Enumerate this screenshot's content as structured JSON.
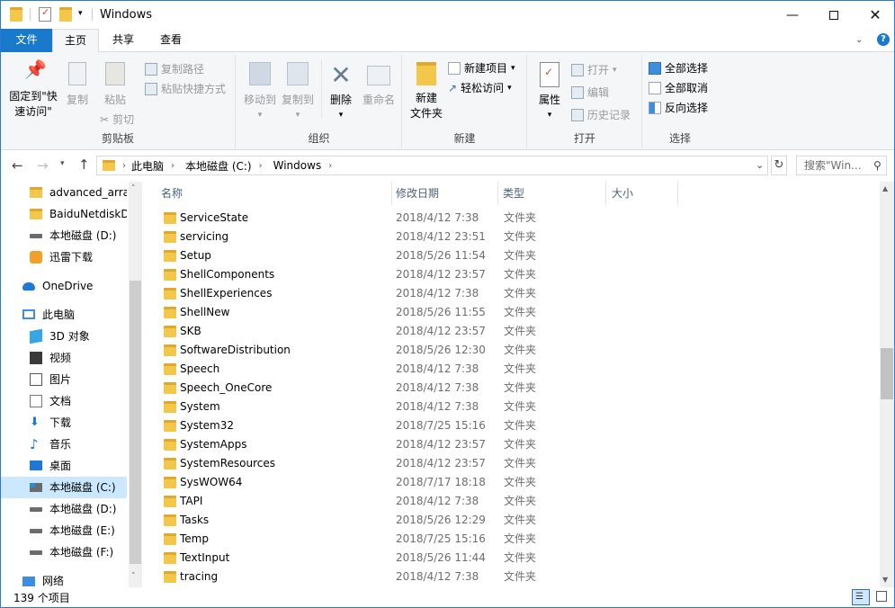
{
  "window": {
    "title": "Windows"
  },
  "tabs": {
    "file": "文件",
    "home": "主页",
    "share": "共享",
    "view": "查看"
  },
  "ribbon": {
    "clipboard": {
      "label": "剪贴板",
      "pin": "固定到\"快",
      "pin2": "速访问\"",
      "copy": "复制",
      "paste": "粘贴",
      "copy_path": "复制路径",
      "paste_shortcut": "粘贴快捷方式",
      "cut": "剪切"
    },
    "organize": {
      "label": "组织",
      "move_to": "移动到",
      "copy_to": "复制到",
      "delete": "删除",
      "rename": "重命名"
    },
    "new": {
      "label": "新建",
      "new_folder": "新建",
      "new_folder2": "文件夹",
      "new_item": "新建项目",
      "easy_access": "轻松访问"
    },
    "open": {
      "label": "打开",
      "properties": "属性",
      "open": "打开",
      "edit": "编辑",
      "history": "历史记录"
    },
    "select": {
      "label": "选择",
      "select_all": "全部选择",
      "select_none": "全部取消",
      "invert": "反向选择"
    }
  },
  "address": {
    "crumbs": [
      "此电脑",
      "本地磁盘 (C:)",
      "Windows"
    ],
    "search_placeholder": "搜索\"Win..."
  },
  "nav": [
    {
      "label": "advanced_arra",
      "icon": "folder-icon"
    },
    {
      "label": "BaiduNetdiskD",
      "icon": "folder-icon"
    },
    {
      "label": "本地磁盘 (D:)",
      "icon": "drive-icon"
    },
    {
      "label": "迅雷下载",
      "icon": "thunder-icon"
    },
    {
      "label": "OneDrive",
      "icon": "cloud-icon"
    },
    {
      "label": "此电脑",
      "icon": "computer-icon"
    },
    {
      "label": "3D 对象",
      "icon": "cube-icon"
    },
    {
      "label": "视频",
      "icon": "video-icon"
    },
    {
      "label": "图片",
      "icon": "picture-icon"
    },
    {
      "label": "文档",
      "icon": "document-icon"
    },
    {
      "label": "下载",
      "icon": "download-icon"
    },
    {
      "label": "音乐",
      "icon": "music-icon"
    },
    {
      "label": "桌面",
      "icon": "desktop-icon"
    },
    {
      "label": "本地磁盘 (C:)",
      "icon": "windows-drive-icon"
    },
    {
      "label": "本地磁盘 (D:)",
      "icon": "drive-icon"
    },
    {
      "label": "本地磁盘 (E:)",
      "icon": "drive-icon"
    },
    {
      "label": "本地磁盘 (F:)",
      "icon": "drive-icon"
    },
    {
      "label": "网络",
      "icon": "network-icon"
    }
  ],
  "columns": {
    "name": "名称",
    "date": "修改日期",
    "type": "类型",
    "size": "大小"
  },
  "files": [
    {
      "name": "ServiceState",
      "date": "2018/4/12 7:38",
      "type": "文件夹"
    },
    {
      "name": "servicing",
      "date": "2018/4/12 23:51",
      "type": "文件夹"
    },
    {
      "name": "Setup",
      "date": "2018/5/26 11:54",
      "type": "文件夹"
    },
    {
      "name": "ShellComponents",
      "date": "2018/4/12 23:57",
      "type": "文件夹"
    },
    {
      "name": "ShellExperiences",
      "date": "2018/4/12 7:38",
      "type": "文件夹"
    },
    {
      "name": "ShellNew",
      "date": "2018/5/26 11:55",
      "type": "文件夹"
    },
    {
      "name": "SKB",
      "date": "2018/4/12 23:57",
      "type": "文件夹"
    },
    {
      "name": "SoftwareDistribution",
      "date": "2018/5/26 12:30",
      "type": "文件夹"
    },
    {
      "name": "Speech",
      "date": "2018/4/12 7:38",
      "type": "文件夹"
    },
    {
      "name": "Speech_OneCore",
      "date": "2018/4/12 7:38",
      "type": "文件夹"
    },
    {
      "name": "System",
      "date": "2018/4/12 7:38",
      "type": "文件夹"
    },
    {
      "name": "System32",
      "date": "2018/7/25 15:16",
      "type": "文件夹"
    },
    {
      "name": "SystemApps",
      "date": "2018/4/12 23:57",
      "type": "文件夹"
    },
    {
      "name": "SystemResources",
      "date": "2018/4/12 23:57",
      "type": "文件夹"
    },
    {
      "name": "SysWOW64",
      "date": "2018/7/17 18:18",
      "type": "文件夹"
    },
    {
      "name": "TAPI",
      "date": "2018/4/12 7:38",
      "type": "文件夹"
    },
    {
      "name": "Tasks",
      "date": "2018/5/26 12:29",
      "type": "文件夹"
    },
    {
      "name": "Temp",
      "date": "2018/7/25 15:16",
      "type": "文件夹"
    },
    {
      "name": "TextInput",
      "date": "2018/5/26 11:44",
      "type": "文件夹"
    },
    {
      "name": "tracing",
      "date": "2018/4/12 7:38",
      "type": "文件夹"
    }
  ],
  "status": {
    "count": "139 个项目"
  },
  "colors": {
    "accent": "#1979ca",
    "folder": "#f3c84a",
    "selected": "#cce8ff"
  }
}
